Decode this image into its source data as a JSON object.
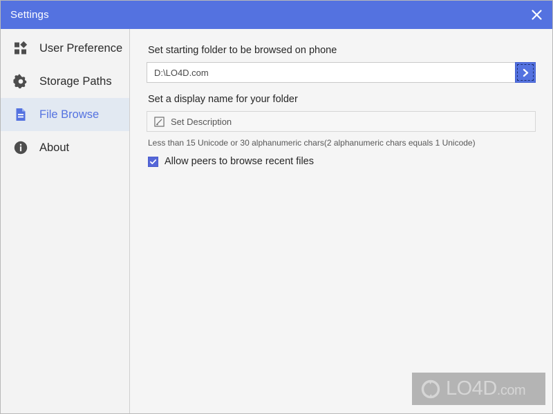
{
  "window": {
    "title": "Settings",
    "accent_color": "#5472e0",
    "sidebar_bg": "#f3f3f3",
    "content_bg": "#f5f5f5",
    "selected_item_bg": "#e2e9f2",
    "checkbox_color": "#5567d8"
  },
  "titlebar": {
    "title": "Settings",
    "close_icon": "close-icon"
  },
  "sidebar": {
    "items": [
      {
        "label": "User Preference",
        "icon": "grid-squares-icon",
        "selected": false
      },
      {
        "label": "Storage Paths",
        "icon": "gear-icon",
        "selected": false
      },
      {
        "label": "File Browse",
        "icon": "document-icon",
        "selected": true
      },
      {
        "label": "About",
        "icon": "info-circle-icon",
        "selected": false
      }
    ]
  },
  "main": {
    "starting_folder": {
      "label": "Set starting folder to be browsed on phone",
      "value": "D:\\LO4D.com",
      "placeholder": "D:\\LO4D.com",
      "go_icon": "chevron-right-icon"
    },
    "display_name": {
      "label": "Set a display name for your folder",
      "button_text": "Set Description",
      "icon": "pencil-edit-icon"
    },
    "helper_text": "Less than 15 Unicode or 30 alphanumeric chars(2 alphanumeric chars equals 1 Unicode)",
    "allow_peers": {
      "label": "Allow peers to browse recent files",
      "checked": true,
      "icon": "checkmark-icon"
    }
  },
  "watermark": {
    "text": "LO4D",
    "suffix": ".com",
    "icon": "refresh-cycle-icon"
  }
}
